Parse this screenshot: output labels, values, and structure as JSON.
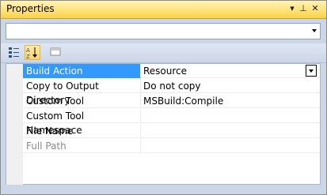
{
  "window": {
    "title": "Properties"
  },
  "titlebar": {
    "dropdown_glyph": "▾",
    "pin_glyph": "⊥",
    "close_glyph": "✕"
  },
  "object_selector": {
    "value": ""
  },
  "toolbar": {
    "icons": [
      "categorized-icon",
      "alphabetical-icon",
      "property-pages-icon"
    ],
    "active": "alphabetical-icon"
  },
  "properties": [
    {
      "name": "Build Action",
      "value": "Resource",
      "selected": true,
      "dim": false,
      "has_dropdown": true
    },
    {
      "name": "Copy to Output Directory",
      "value": "Do not copy",
      "selected": false,
      "dim": false,
      "has_dropdown": false
    },
    {
      "name": "Custom Tool",
      "value": "MSBuild:Compile",
      "selected": false,
      "dim": false,
      "has_dropdown": false
    },
    {
      "name": "Custom Tool Namespace",
      "value": "",
      "selected": false,
      "dim": false,
      "has_dropdown": false
    },
    {
      "name": "File Name",
      "value": "",
      "selected": false,
      "dim": false,
      "has_dropdown": false
    },
    {
      "name": "Full Path",
      "value": "",
      "selected": false,
      "dim": true,
      "has_dropdown": false
    }
  ],
  "colors": {
    "accent": "#3399ff",
    "titlebar": "#ffe27a",
    "panel": "#cbd6e7"
  }
}
